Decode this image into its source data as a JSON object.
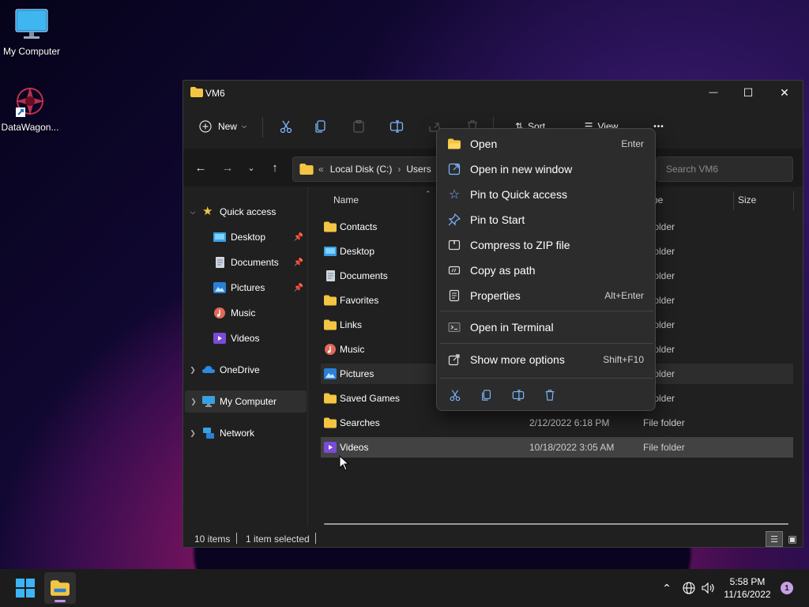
{
  "desktop": {
    "icons": [
      {
        "label": "My Computer"
      },
      {
        "label": "DataWagon..."
      }
    ]
  },
  "window": {
    "title": "VM6",
    "controls": {
      "minimize": "—",
      "maximize": "☐",
      "close": "✕"
    }
  },
  "toolbar": {
    "new_label": "New",
    "sort_label": "Sort",
    "view_label": "View",
    "more_label": "•••"
  },
  "address": {
    "prefix": "«",
    "crumbs": [
      "Local Disk (C:)",
      "Users"
    ],
    "separator": "›",
    "search_placeholder": "Search VM6"
  },
  "sidebar": {
    "items": [
      {
        "label": "Quick access",
        "icon": "star-icon"
      },
      {
        "label": "Desktop",
        "icon": "desktop-folder-icon",
        "pinned": true
      },
      {
        "label": "Documents",
        "icon": "documents-icon",
        "pinned": true
      },
      {
        "label": "Pictures",
        "icon": "pictures-icon",
        "pinned": true
      },
      {
        "label": "Music",
        "icon": "music-icon"
      },
      {
        "label": "Videos",
        "icon": "videos-icon"
      },
      {
        "label": "OneDrive",
        "icon": "cloud-icon"
      },
      {
        "label": "My Computer",
        "icon": "computer-icon"
      },
      {
        "label": "Network",
        "icon": "network-icon"
      }
    ]
  },
  "columns": {
    "name": "Name",
    "type": "pe",
    "size": "Size"
  },
  "files": [
    {
      "name": "Contacts",
      "date": "",
      "type": "e folder"
    },
    {
      "name": "Desktop",
      "date": "",
      "type": "e folder"
    },
    {
      "name": "Documents",
      "date": "",
      "type": "e folder"
    },
    {
      "name": "Favorites",
      "date": "",
      "type": "e folder"
    },
    {
      "name": "Links",
      "date": "",
      "type": "e folder"
    },
    {
      "name": "Music",
      "date": "",
      "type": "e folder"
    },
    {
      "name": "Pictures",
      "date": "",
      "type": "e folder"
    },
    {
      "name": "Saved Games",
      "date": "",
      "type": "e folder"
    },
    {
      "name": "Searches",
      "date": "2/12/2022 6:18 PM",
      "type": "File folder"
    },
    {
      "name": "Videos",
      "date": "10/18/2022 3:05 AM",
      "type": "File folder"
    }
  ],
  "status": {
    "items": "10 items",
    "selected": "1 item selected"
  },
  "context_menu": {
    "items": [
      {
        "label": "Open",
        "key": "Enter",
        "icon": "folder-open-icon"
      },
      {
        "label": "Open in new window",
        "key": "",
        "icon": "open-new-window-icon"
      },
      {
        "label": "Pin to Quick access",
        "key": "",
        "icon": "star-outline-icon"
      },
      {
        "label": "Pin to Start",
        "key": "",
        "icon": "pin-icon"
      },
      {
        "label": "Compress to ZIP file",
        "key": "",
        "icon": "zip-icon"
      },
      {
        "label": "Copy as path",
        "key": "",
        "icon": "copy-path-icon"
      },
      {
        "label": "Properties",
        "key": "Alt+Enter",
        "icon": "properties-icon"
      },
      {
        "label": "Open in Terminal",
        "key": "",
        "icon": "terminal-icon"
      },
      {
        "label": "Show more options",
        "key": "Shift+F10",
        "icon": "more-options-icon"
      }
    ]
  },
  "taskbar": {
    "time": "5:58 PM",
    "date": "11/16/2022",
    "notification_count": "1"
  },
  "colors": {
    "accent": "#60cdff",
    "folder": "#f4c542",
    "window_bg": "#202020",
    "menu_bg": "#2c2c2c"
  }
}
